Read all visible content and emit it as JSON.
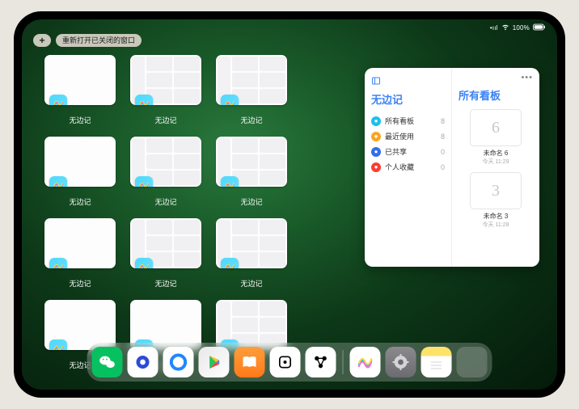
{
  "status": {
    "signal": "•ıl",
    "wifi_icon": "wifi",
    "battery": "100%"
  },
  "top": {
    "plus_label": "+",
    "reopen_label": "重新打开已关闭的窗口"
  },
  "switcher": {
    "app_label": "无边记",
    "cards": [
      {
        "variant": "plain"
      },
      {
        "variant": "grid"
      },
      {
        "variant": "grid"
      },
      {
        "variant": "plain"
      },
      {
        "variant": "grid"
      },
      {
        "variant": "grid"
      },
      {
        "variant": "plain"
      },
      {
        "variant": "grid"
      },
      {
        "variant": "grid"
      },
      {
        "variant": "plain"
      },
      {
        "variant": "plain"
      },
      {
        "variant": "grid"
      }
    ]
  },
  "panel": {
    "left_title": "无边记",
    "right_title": "所有看板",
    "sidebar": [
      {
        "color": "#19c0ee",
        "label": "所有看板",
        "count": "8"
      },
      {
        "color": "#f6a623",
        "label": "最近使用",
        "count": "8"
      },
      {
        "color": "#2f6fed",
        "label": "已共享",
        "count": "0"
      },
      {
        "color": "#ff3b30",
        "label": "个人收藏",
        "count": "0"
      }
    ],
    "boards": [
      {
        "glyph": "6",
        "name": "未命名 6",
        "date": "今天 11:29"
      },
      {
        "glyph": "3",
        "name": "未命名 3",
        "date": "今天 11:28"
      }
    ]
  },
  "dock": {
    "apps": [
      {
        "name": "wechat-icon"
      },
      {
        "name": "browser-icon"
      },
      {
        "name": "qq-browser-icon"
      },
      {
        "name": "play-icon"
      },
      {
        "name": "books-icon"
      },
      {
        "name": "game-icon"
      },
      {
        "name": "connect-icon"
      },
      {
        "name": "freeform-icon"
      },
      {
        "name": "settings-icon"
      },
      {
        "name": "notes-icon"
      }
    ]
  }
}
